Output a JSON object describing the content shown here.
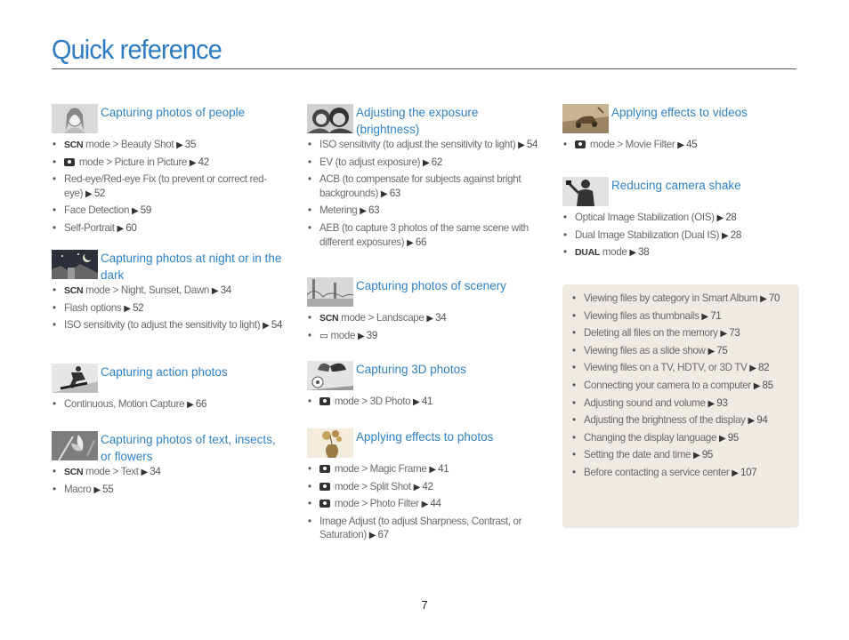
{
  "page": {
    "title": "Quick reference",
    "page_number": "7"
  },
  "sections": {
    "people": {
      "title": "Capturing photos of people",
      "items": [
        {
          "icon": "SCN",
          "text": " mode > Beauty Shot ",
          "ref": "35"
        },
        {
          "icon": "camera",
          "text": " mode > Picture in Picture ",
          "ref": "42"
        },
        {
          "text": "Red-eye/Red-eye Fix (to prevent or correct red-eye) ",
          "ref": "52"
        },
        {
          "text": "Face Detection ",
          "ref": "59"
        },
        {
          "text": "Self-Portrait ",
          "ref": "60"
        }
      ]
    },
    "night": {
      "title": "Capturing photos at night or in the dark",
      "items": [
        {
          "icon": "SCN",
          "text": " mode > Night, Sunset, Dawn ",
          "ref": "34"
        },
        {
          "text": "Flash options ",
          "ref": "52"
        },
        {
          "text": "ISO sensitivity (to adjust the sensitivity to light) ",
          "ref": "54"
        }
      ]
    },
    "action": {
      "title": "Capturing action photos",
      "items": [
        {
          "text": "Continuous, Motion Capture ",
          "ref": "66"
        }
      ]
    },
    "text": {
      "title": "Capturing photos of text, insects, or flowers",
      "items": [
        {
          "icon": "SCN",
          "text": " mode > Text ",
          "ref": "34"
        },
        {
          "text": "Macro ",
          "ref": "55"
        }
      ]
    },
    "exposure": {
      "title": "Adjusting the exposure (brightness)",
      "items": [
        {
          "text": "ISO sensitivity (to adjust the sensitivity to light) ",
          "ref": "54"
        },
        {
          "text": "EV (to adjust exposure) ",
          "ref": "62"
        },
        {
          "text": "ACB (to compensate for subjects against bright backgrounds) ",
          "ref": "63"
        },
        {
          "text": "Metering ",
          "ref": "63"
        },
        {
          "text": "AEB (to capture 3 photos of the same scene with different exposures) ",
          "ref": "66"
        }
      ]
    },
    "scenery": {
      "title": "Capturing photos of scenery",
      "items": [
        {
          "icon": "SCN",
          "text": " mode > Landscape ",
          "ref": "34"
        },
        {
          "icon": "panorama",
          "text": " mode ",
          "ref": "39"
        }
      ]
    },
    "photo3d": {
      "title": "Capturing 3D photos",
      "items": [
        {
          "icon": "camera",
          "text": " mode > 3D Photo ",
          "ref": "41"
        }
      ]
    },
    "effects_photos": {
      "title": "Applying effects to photos",
      "items": [
        {
          "icon": "camera",
          "text": " mode > Magic Frame ",
          "ref": "41"
        },
        {
          "icon": "camera",
          "text": " mode > Split Shot ",
          "ref": "42"
        },
        {
          "icon": "camera",
          "text": " mode > Photo Filter ",
          "ref": "44"
        },
        {
          "text": "Image Adjust (to adjust Sharpness, Contrast, or Saturation) ",
          "ref": "67"
        }
      ]
    },
    "effects_videos": {
      "title": "Applying effects to videos",
      "items": [
        {
          "icon": "camera",
          "text": " mode > Movie Filter ",
          "ref": "45"
        }
      ]
    },
    "shake": {
      "title": "Reducing camera shake",
      "items": [
        {
          "text": "Optical Image Stabilization (OIS) ",
          "ref": "28"
        },
        {
          "text": "Dual Image Stabilization (Dual IS) ",
          "ref": "28"
        },
        {
          "icon": "DUAL",
          "text": " mode ",
          "ref": "38"
        }
      ]
    }
  },
  "other_list": [
    {
      "text": "Viewing files by category in Smart Album ",
      "ref": "70"
    },
    {
      "text": "Viewing files as thumbnails ",
      "ref": "71"
    },
    {
      "text": "Deleting all files on the memory ",
      "ref": "73"
    },
    {
      "text": "Viewing files as a slide show ",
      "ref": "75"
    },
    {
      "text": "Viewing files on a TV, HDTV, or 3D TV ",
      "ref": "82"
    },
    {
      "text": "Connecting your camera to a computer ",
      "ref": "85"
    },
    {
      "text": "Adjusting sound and volume ",
      "ref": "93"
    },
    {
      "text": "Adjusting the brightness of the display ",
      "ref": "94"
    },
    {
      "text": "Changing the display language ",
      "ref": "95"
    },
    {
      "text": "Setting the date and time ",
      "ref": "95"
    },
    {
      "text": "Before contacting a service center ",
      "ref": "107"
    }
  ],
  "glyphs": {
    "arrow": "▶"
  },
  "colors": {
    "title": "#2d7bc2",
    "heading": "#2f82c6",
    "box": "#efebe4"
  }
}
